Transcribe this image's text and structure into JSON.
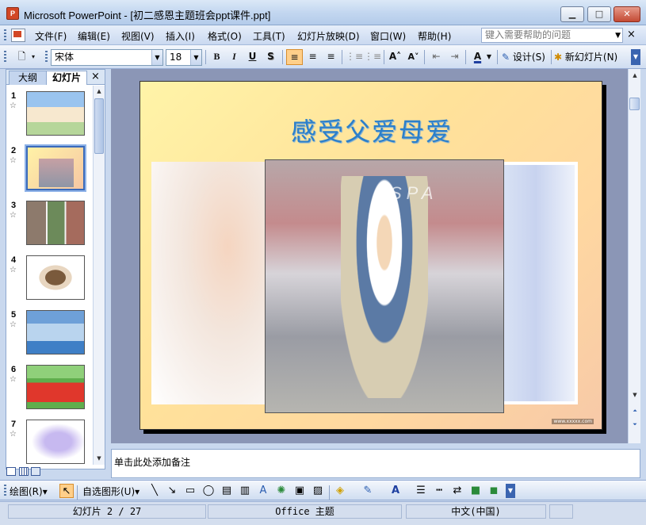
{
  "window": {
    "title": "Microsoft PowerPoint - [初二感恩主题班会ppt课件.ppt]",
    "app_icon_label": "P",
    "minimize_glyph": "▁",
    "maximize_glyph": "□",
    "close_glyph": "✕"
  },
  "menubar": {
    "items": [
      "文件(F)",
      "编辑(E)",
      "视图(V)",
      "插入(I)",
      "格式(O)",
      "工具(T)",
      "幻灯片放映(D)",
      "窗口(W)",
      "帮助(H)"
    ],
    "help_placeholder": "键入需要帮助的问题",
    "doc_close": "×"
  },
  "toolbar": {
    "font_name": "宋体",
    "font_size": "18",
    "bold": "B",
    "italic": "I",
    "underline": "U",
    "shadow": "S",
    "align_left": "≡",
    "align_center": "≡",
    "align_right": "≡",
    "numbering": "⋮≡",
    "bullets": "⋮≡",
    "grow_font": "A˄",
    "shrink_font": "A˅",
    "decrease_indent": "⇤",
    "increase_indent": "⇥",
    "font_color": "A",
    "design_label": "设计(S)",
    "new_slide_label": "新幻灯片(N)"
  },
  "outline_pane": {
    "tab_outline": "大纲",
    "tab_slides": "幻灯片",
    "close": "×",
    "slides": [
      {
        "num": "1",
        "selected": false
      },
      {
        "num": "2",
        "selected": true
      },
      {
        "num": "3",
        "selected": false
      },
      {
        "num": "4",
        "selected": false
      },
      {
        "num": "5",
        "selected": false
      },
      {
        "num": "6",
        "selected": false
      },
      {
        "num": "7",
        "selected": false
      }
    ],
    "star": "☆"
  },
  "slide": {
    "title": "感受父爱母爱",
    "watermark": "SPA",
    "footer_url": "www.xxxxx.com"
  },
  "notes": {
    "placeholder": "单击此处添加备注"
  },
  "drawbar": {
    "draw_label": "绘图(R)",
    "autoshapes_label": "自选图形(U)"
  },
  "statusbar": {
    "slide_info": "幻灯片 2 / 27",
    "theme": "Office 主题",
    "language": "中文(中国)"
  }
}
